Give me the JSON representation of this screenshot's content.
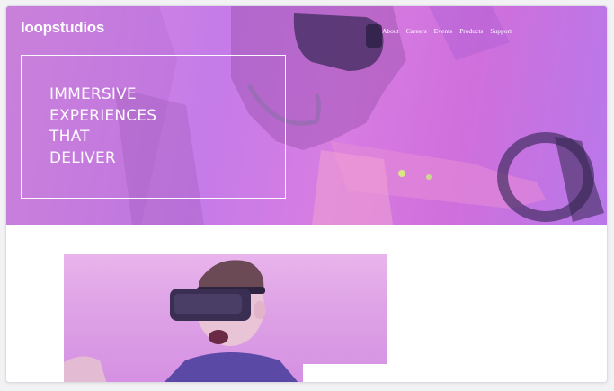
{
  "brand": {
    "logo": "loopstudios"
  },
  "nav": {
    "items": [
      {
        "label": "About"
      },
      {
        "label": "Careers"
      },
      {
        "label": "Events"
      },
      {
        "label": "Products"
      },
      {
        "label": "Support"
      }
    ]
  },
  "hero": {
    "headline_lines": [
      "IMMERSIVE",
      "EXPERIENCES",
      "THAT",
      "DELIVER"
    ]
  },
  "colors": {
    "hero_tint": "#d37fe4",
    "content_image_tint": "#e0a6e8"
  },
  "icons": {
    "hero_image": "vr-headset-racing-photo",
    "content_image": "man-wearing-vr-headset-photo"
  }
}
